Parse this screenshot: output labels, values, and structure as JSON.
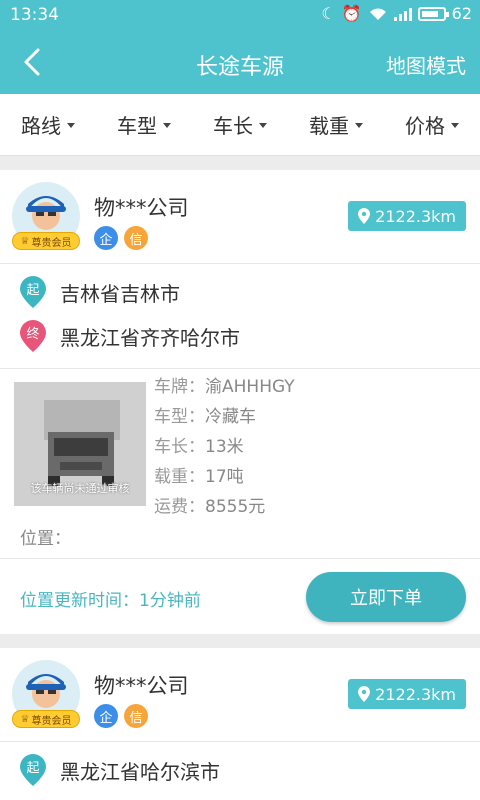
{
  "status_bar": {
    "time": "13:34",
    "battery": "62"
  },
  "header": {
    "title": "长途车源",
    "map_mode": "地图模式"
  },
  "filters": [
    {
      "label": "路线"
    },
    {
      "label": "车型"
    },
    {
      "label": "车长"
    },
    {
      "label": "载重"
    },
    {
      "label": "价格"
    }
  ],
  "cards": [
    {
      "company": "物***公司",
      "vip_label": "尊贵会员",
      "badge_enterprise": "企",
      "badge_credit": "信",
      "distance": "2122.3km",
      "origin_tag": "起",
      "origin": "吉林省吉林市",
      "dest_tag": "终",
      "destination": "黑龙江省齐齐哈尔市",
      "image_caption": "该车辆尚未通过审核",
      "specs": {
        "plate_label": "车牌：",
        "plate": "渝AHHHGY",
        "type_label": "车型：",
        "type": "冷藏车",
        "length_label": "车长：",
        "length": "13米",
        "load_label": "载重：",
        "load": "17吨",
        "fee_label": "运费：",
        "fee": "8555元"
      },
      "position_label": "位置：",
      "update_text": "位置更新时间：1分钟前",
      "order_button": "立即下单"
    },
    {
      "company": "物***公司",
      "vip_label": "尊贵会员",
      "badge_enterprise": "企",
      "badge_credit": "信",
      "distance": "2122.3km",
      "origin_tag": "起",
      "origin": "黑龙江省哈尔滨市"
    }
  ],
  "colors": {
    "accent": "#4ec3cd",
    "button": "#3fb4bf",
    "origin_pin": "#3cb6c2",
    "dest_pin": "#e8557a"
  }
}
